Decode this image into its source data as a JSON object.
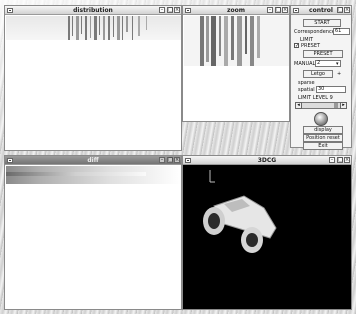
{
  "windows": {
    "distribution": {
      "title": "distribution"
    },
    "zoom": {
      "title": "zoom"
    },
    "control": {
      "title": "control",
      "start_label": "START",
      "correspondence_label": "Correspondence",
      "correspondence_value": "61",
      "limit_label": "LIMIT",
      "preset_check_label": "PRESET",
      "preset_button_label": "PRESET",
      "manual_label": "MANUAL",
      "manual_value": "2",
      "letgo_label": "Letgo",
      "sparse_label": "sparse",
      "spatial_label": "spatial",
      "spatial_value": "30",
      "limit_level_label": "LIMIT LEVEL 9",
      "display_label": "display",
      "position_reset_label": "Position reset",
      "exit_label": "Exit"
    },
    "diff": {
      "title": "diff"
    },
    "view3d": {
      "title": "3DCG"
    }
  },
  "title_buttons": {
    "minimize": "–",
    "maximize": "□",
    "close": "×"
  }
}
